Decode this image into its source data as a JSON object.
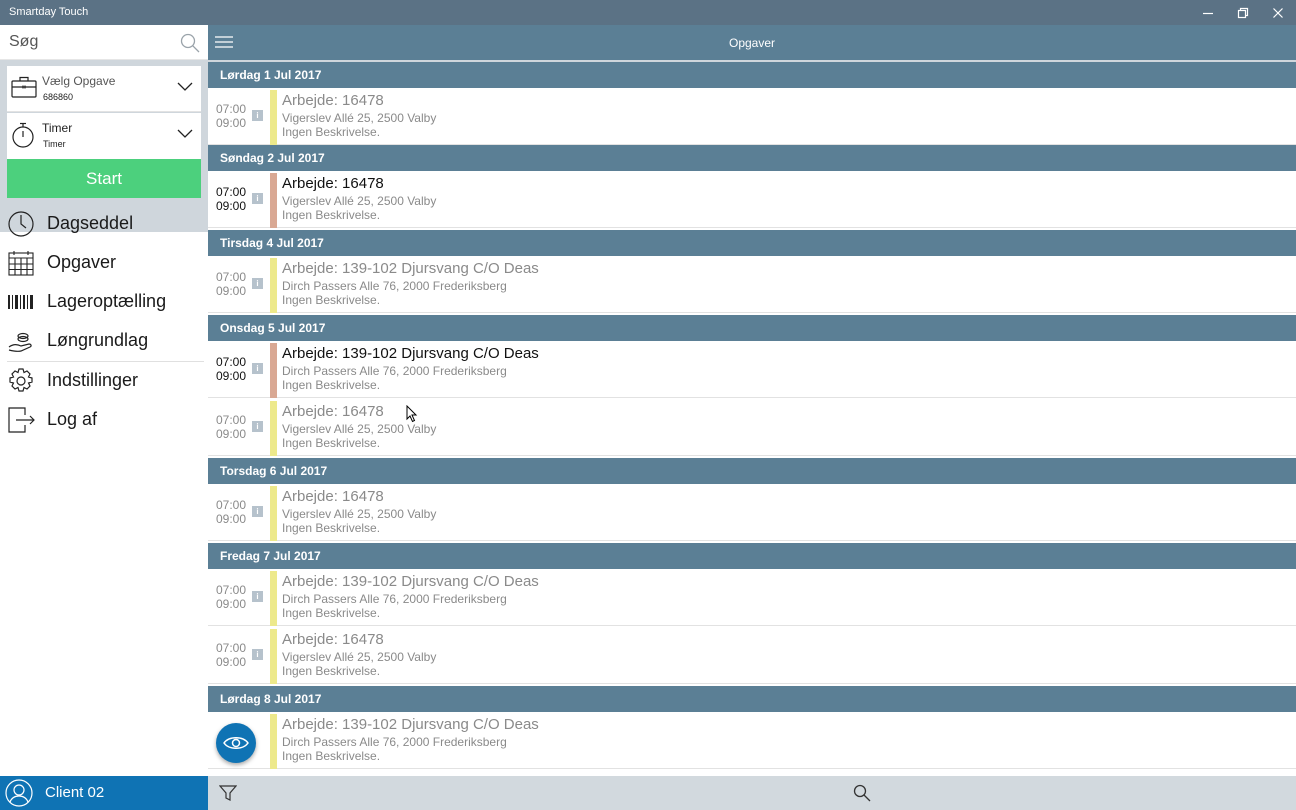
{
  "window": {
    "title": "Smartday Touch"
  },
  "sidebar": {
    "search": {
      "placeholder": "Søg",
      "value": ""
    },
    "task_selector": {
      "label": "Vælg Opgave",
      "value": "686860"
    },
    "type_selector": {
      "label": "Timer",
      "value": "Timer"
    },
    "start_label": "Start",
    "menu": [
      {
        "label": "Dagseddel",
        "icon": "clock-icon"
      },
      {
        "label": "Opgaver",
        "icon": "calendar-icon"
      },
      {
        "label": "Lageroptælling",
        "icon": "barcode-icon"
      },
      {
        "label": "Løngrundlag",
        "icon": "hand-money-icon"
      },
      {
        "label": "Indstillinger",
        "icon": "gear-icon"
      },
      {
        "label": "Log af",
        "icon": "logout-icon"
      }
    ],
    "user": {
      "name": "Client 02"
    }
  },
  "header": {
    "title": "Opgaver"
  },
  "days": [
    {
      "date": "Lørdag 1 Jul 2017"
    },
    {
      "date": "Søndag 2 Jul 2017"
    },
    {
      "date": "Tirsdag 4 Jul 2017"
    },
    {
      "date": "Onsdag 5 Jul 2017"
    },
    {
      "date": "Torsdag 6 Jul 2017"
    },
    {
      "date": "Fredag 7 Jul 2017"
    },
    {
      "date": "Lørdag 8 Jul 2017"
    }
  ],
  "tasks": [
    {
      "start": "07:00",
      "end": "09:00",
      "info": "i",
      "title": "Arbejde: 16478",
      "address": "Vigerslev Allé 25, 2500 Valby",
      "description": "Ingen Beskrivelse.",
      "status_color": "#ede98b",
      "active": false
    },
    {
      "start": "07:00",
      "end": "09:00",
      "info": "i",
      "title": "Arbejde: 16478",
      "address": "Vigerslev Allé 25, 2500 Valby",
      "description": "Ingen Beskrivelse.",
      "status_color": "#d9a893",
      "active": true
    },
    {
      "start": "07:00",
      "end": "09:00",
      "info": "i",
      "title": "Arbejde: 139-102 Djursvang C/O Deas",
      "address": "Dirch Passers Alle 76, 2000 Frederiksberg",
      "description": "Ingen Beskrivelse.",
      "status_color": "#ede98b",
      "active": false
    },
    {
      "start": "07:00",
      "end": "09:00",
      "info": "i",
      "title": "Arbejde: 139-102 Djursvang C/O Deas",
      "address": "Dirch Passers Alle 76, 2000 Frederiksberg",
      "description": "Ingen Beskrivelse.",
      "status_color": "#d9a893",
      "active": true
    },
    {
      "start": "07:00",
      "end": "09:00",
      "info": "i",
      "title": "Arbejde: 16478",
      "address": "Vigerslev Allé 25, 2500 Valby",
      "description": "Ingen Beskrivelse.",
      "status_color": "#ede98b",
      "active": false
    },
    {
      "start": "07:00",
      "end": "09:00",
      "info": "i",
      "title": "Arbejde: 16478",
      "address": "Vigerslev Allé 25, 2500 Valby",
      "description": "Ingen Beskrivelse.",
      "status_color": "#ede98b",
      "active": false
    },
    {
      "start": "07:00",
      "end": "09:00",
      "info": "i",
      "title": "Arbejde: 139-102 Djursvang C/O Deas",
      "address": "Dirch Passers Alle 76, 2000 Frederiksberg",
      "description": "Ingen Beskrivelse.",
      "status_color": "#ede98b",
      "active": false
    },
    {
      "start": "07:00",
      "end": "09:00",
      "info": "i",
      "title": "Arbejde: 16478",
      "address": "Vigerslev Allé 25, 2500 Valby",
      "description": "Ingen Beskrivelse.",
      "status_color": "#ede98b",
      "active": false
    },
    {
      "start": "",
      "end": "",
      "info": "",
      "title": "Arbejde: 139-102 Djursvang C/O Deas",
      "address": "Dirch Passers Alle 76, 2000 Frederiksberg",
      "description": "Ingen Beskrivelse.",
      "status_color": "#ede98b",
      "active": false
    }
  ],
  "colors": {
    "title_bar": "#5b7285",
    "header": "#5b7f95",
    "start_button": "#4cd07d",
    "user_bar": "#0f73b4",
    "active_status": "#d9a893",
    "default_status": "#ede98b"
  }
}
